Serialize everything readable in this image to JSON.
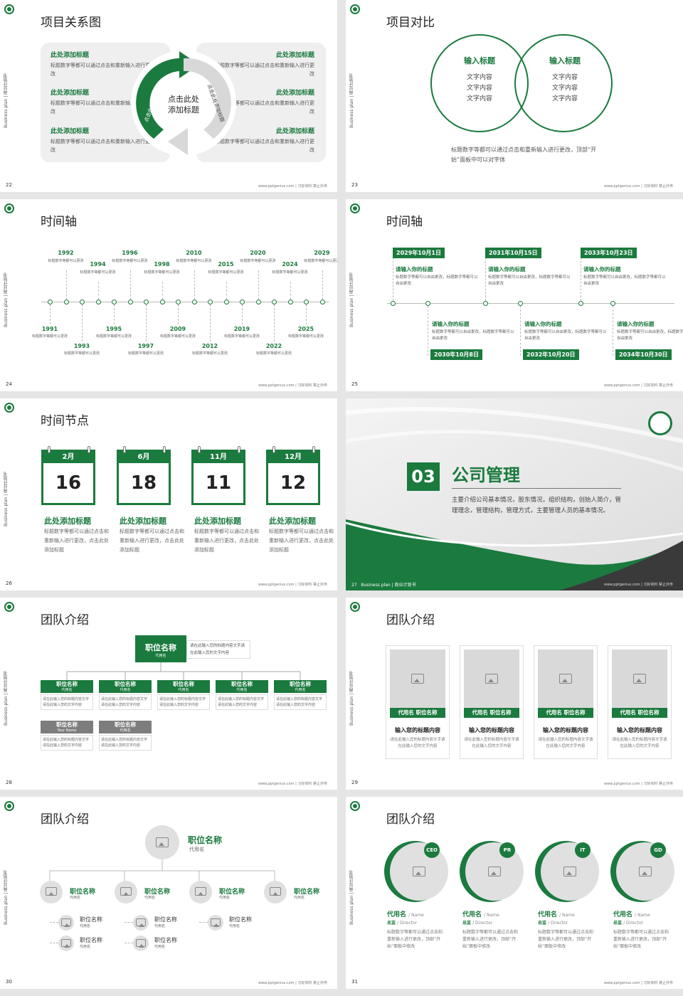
{
  "common": {
    "vertical_text": "Business plan | 商业计划书",
    "footer": "www.pptgenius.com | 习好资料 禁止外传"
  },
  "s22": {
    "page": "22",
    "title": "项目关系图",
    "center_text": "点击此处\n添加标题",
    "arc_left": "点击此处添加标题",
    "arc_right": "点击此处添加标题",
    "items_left": [
      {
        "title": "此处添加标题",
        "text": "标题数字等都可以通过点击和重新输入进行更改"
      },
      {
        "title": "此处添加标题",
        "text": "标题数字等都可以通过点击和重新输入进行更改"
      },
      {
        "title": "此处添加标题",
        "text": "标题数字等都可以通过点击和重新输入进行更改"
      }
    ],
    "items_right": [
      {
        "title": "此处添加标题",
        "text": "标题数字等都可以通过点击和重新输入进行更改"
      },
      {
        "title": "此处添加标题",
        "text": "标题数字等都可以通过点击和重新输入进行更改"
      },
      {
        "title": "此处添加标题",
        "text": "标题数字等都可以通过点击和重新输入进行更改"
      }
    ]
  },
  "s23": {
    "page": "23",
    "title": "项目对比",
    "left_title": "输入标题",
    "right_title": "输入标题",
    "left_lines": [
      "文字内容",
      "文字内容",
      "文字内容"
    ],
    "right_lines": [
      "文字内容",
      "文字内容",
      "文字内容"
    ],
    "desc": "标题数字等都可以通过点击和重新输入进行更改，顶部“开始”面板中可以对字体"
  },
  "s24": {
    "page": "24",
    "title": "时间轴",
    "desc": "标题数字等都可以更改",
    "top_years": [
      "1992",
      "1994",
      "1996",
      "1998",
      "2010",
      "2015",
      "2020",
      "2024",
      "2029"
    ],
    "bottom_years": [
      "1991",
      "1993",
      "1995",
      "1997",
      "2009",
      "2012",
      "2019",
      "2022",
      "2025"
    ]
  },
  "s25": {
    "page": "25",
    "title": "时间轴",
    "heading": "请输入你的标题",
    "text": "标题数字等都可以自由更改，标题数字等都可以自由更改",
    "top_dates": [
      "2029年10月1日",
      "2031年10月15日",
      "2033年10月23日"
    ],
    "bottom_dates": [
      "2030年10月8日",
      "2032年10月20日",
      "2034年10月30日"
    ]
  },
  "s26": {
    "page": "26",
    "title": "时间节点",
    "cards": [
      {
        "month": "2月",
        "day": "16",
        "title": "此处添加标题",
        "text": "标题数字等都可以通过点击和重新输入进行更改，点击此处添加标题"
      },
      {
        "month": "6月",
        "day": "18",
        "title": "此处添加标题",
        "text": "标题数字等都可以通过点击和重新输入进行更改，点击此处添加标题"
      },
      {
        "month": "11月",
        "day": "11",
        "title": "此处添加标题",
        "text": "标题数字等都可以通过点击和重新输入进行更改，点击此处添加标题"
      },
      {
        "month": "12月",
        "day": "12",
        "title": "此处添加标题",
        "text": "标题数字等都可以通过点击和重新输入进行更改，点击此处添加标题"
      }
    ]
  },
  "s27": {
    "page": "27",
    "number": "03",
    "section": "公司管理",
    "desc": "主要介绍公司基本情况，股东情况，组织结构，创始人简介，管理理念，管理结构，管理方式，主要管理人员的基本情况。",
    "footer_left": "Business plan | 商业计划书"
  },
  "s28": {
    "page": "28",
    "title": "团队介绍",
    "top_name": "职位名称",
    "top_sub": "代用名",
    "top_desc": "请在此输入您的标题内容文字请在此输入您的文字内容",
    "box_name": "职位名称",
    "box_sub_green": "代用名",
    "box_sub_gray": "Your Name",
    "box_desc": "请在此输入您的标题内容文字请在此输入您的文字内容"
  },
  "s29": {
    "page": "29",
    "title": "团队介绍",
    "bar": "代用名 职位名称",
    "heading": "输入您的标题内容",
    "text": "请在此输入您的标题内容文字请在此输入您的文字内容"
  },
  "s30": {
    "page": "30",
    "title": "团队介绍",
    "top_name": "职位名称",
    "top_sub": "代用名",
    "name": "职位名称",
    "sub": "代用名"
  },
  "s31": {
    "page": "31",
    "title": "团队介绍",
    "badges": [
      "CEO",
      "PR",
      "IT",
      "GD"
    ],
    "name": "代用名",
    "name_en": "/ Name",
    "role": "总监",
    "role_en": "/ Director",
    "text": "标题数字等都可以通过点击和重新输入进行更改，顶部“开始”面板中修改"
  }
}
